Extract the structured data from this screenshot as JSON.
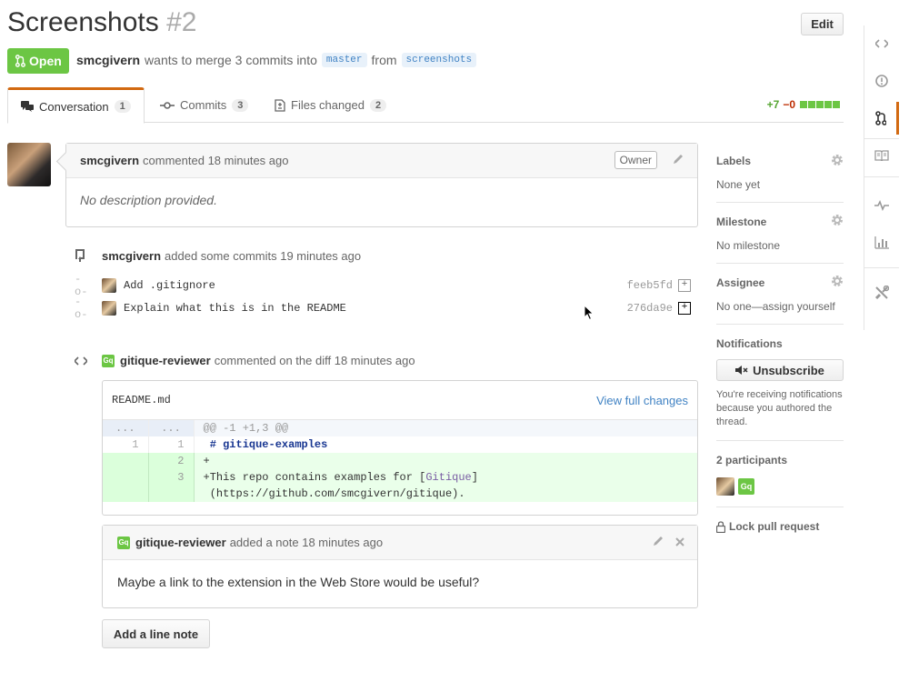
{
  "header": {
    "title": "Screenshots",
    "number": "#2",
    "edit_label": "Edit",
    "state": "Open",
    "author": "smcgivern",
    "merge_text": "wants to merge 3 commits into",
    "base_branch": "master",
    "from_text": "from",
    "head_branch": "screenshots"
  },
  "tabs": [
    {
      "label": "Conversation",
      "count": "1"
    },
    {
      "label": "Commits",
      "count": "3"
    },
    {
      "label": "Files changed",
      "count": "2"
    }
  ],
  "diffstat": {
    "additions": "+7",
    "deletions": "−0"
  },
  "comment": {
    "author": "smcgivern",
    "meta": "commented 18 minutes ago",
    "badge": "Owner",
    "body": "No description provided."
  },
  "commits_event": {
    "author": "smcgivern",
    "meta": "added some commits 19 minutes ago",
    "commits": [
      {
        "message": "Add .gitignore",
        "sha": "feeb5fd"
      },
      {
        "message": "Explain what this is in the README",
        "sha": "276da9e"
      }
    ]
  },
  "diff_event": {
    "author": "gitique-reviewer",
    "meta": "commented on the diff 18 minutes ago",
    "file": "README.md",
    "view_full": "View full changes",
    "hunk_ellipsis": "...",
    "hunk_header": "@@ -1 +1,3 @@",
    "lines": [
      {
        "old": "1",
        "new": "1",
        "text": " # gitique-examples"
      },
      {
        "old": "",
        "new": "2",
        "text": "+"
      },
      {
        "old": "",
        "new": "3",
        "text_prefix": "+This repo contains examples for [",
        "text_link": "Gitique",
        "text_suffix": "]"
      },
      {
        "old": "",
        "new": "",
        "text": " (https://github.com/smcgivern/gitique)."
      }
    ]
  },
  "note": {
    "author": "gitique-reviewer",
    "meta": "added a note 18 minutes ago",
    "body": "Maybe a link to the extension in the Web Store would be useful?"
  },
  "add_line_note": "Add a line note",
  "sidebar": {
    "labels_title": "Labels",
    "labels_value": "None yet",
    "milestone_title": "Milestone",
    "milestone_value": "No milestone",
    "assignee_title": "Assignee",
    "assignee_value": "No one—assign yourself",
    "notifications_title": "Notifications",
    "unsubscribe_label": "Unsubscribe",
    "notifications_note": "You're receiving notifications because you authored the thread.",
    "participants_title": "2 participants",
    "lock_label": "Lock pull request"
  },
  "avatar_initials": "Gq",
  "colors": {
    "open": "#6cc644",
    "accent": "#d26911",
    "link": "#4183c4"
  },
  "icons": [
    "code-icon",
    "issue-icon",
    "pull-request-icon",
    "wiki-icon",
    "pulse-icon",
    "graph-icon",
    "settings-icon"
  ]
}
